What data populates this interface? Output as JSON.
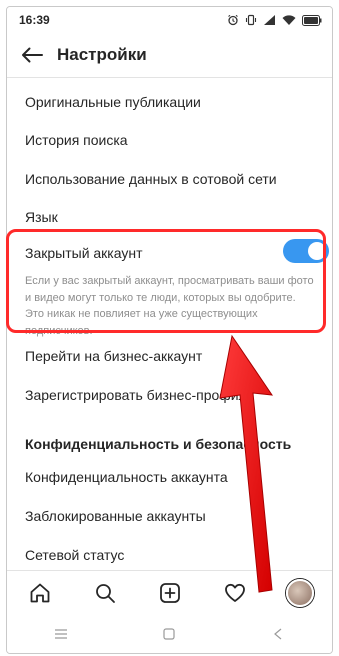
{
  "statusbar": {
    "time": "16:39"
  },
  "header": {
    "title": "Настройки"
  },
  "settings": {
    "items": [
      {
        "label": "Оригинальные публикации"
      },
      {
        "label": "История поиска"
      },
      {
        "label": "Использование данных в сотовой сети"
      },
      {
        "label": "Язык"
      }
    ],
    "private_account": {
      "title": "Закрытый аккаунт",
      "enabled": true,
      "description": "Если у вас закрытый аккаунт, просматривать ваши фото и видео могут только те люди, которых вы одобрите. Это никак не повлияет на уже существующих подписчиков."
    },
    "items_after": [
      {
        "label": "Перейти на бизнес-аккаунт"
      },
      {
        "label": "Зарегистрировать бизнес-профиль"
      }
    ],
    "privacy_section": {
      "title": "Конфиденциальность и безопасность"
    },
    "privacy_items": [
      {
        "label": "Конфиденциальность аккаунта"
      },
      {
        "label": "Заблокированные аккаунты"
      },
      {
        "label": "Сетевой статус"
      }
    ]
  },
  "colors": {
    "accent": "#3897f0",
    "highlight": "#ff2a2a"
  },
  "icons": {
    "status": [
      "alarm-icon",
      "vibrate-icon",
      "signal-icon",
      "wifi-icon",
      "battery-icon"
    ],
    "bottom_nav": [
      "home-icon",
      "search-icon",
      "add-icon",
      "heart-icon",
      "profile-avatar"
    ],
    "system_nav": [
      "menu-icon",
      "home-square-icon",
      "back-triangle-icon"
    ]
  }
}
